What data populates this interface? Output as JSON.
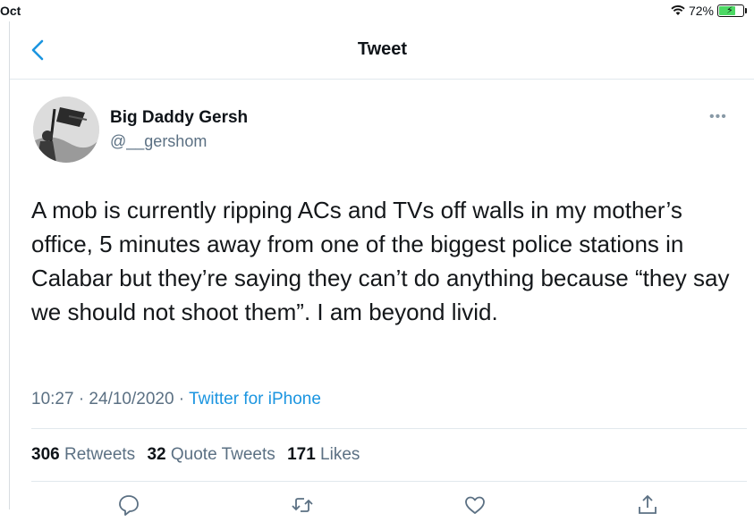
{
  "status_bar": {
    "time": "Oct",
    "battery_percent_text": "72%",
    "battery_level": 0.72
  },
  "nav": {
    "back_icon": "chevron-left-icon",
    "title": "Tweet"
  },
  "tweet": {
    "author_name": "Big Daddy Gersh",
    "author_handle": "@__gershom",
    "more_icon": "more-icon",
    "text": "A mob is currently ripping ACs and TVs off walls in my mother’s office, 5 minutes away from one of the biggest police stations in Calabar but they’re saying they can’t do anything because “they say we should not shoot them”. I am beyond livid.",
    "timestamp": "10:27 · 24/10/2020",
    "separator": " · ",
    "source": "Twitter for iPhone",
    "stats": {
      "retweets_count": "306",
      "retweets_label": "Retweets",
      "quotes_count": "32",
      "quotes_label": "Quote Tweets",
      "likes_count": "171",
      "likes_label": "Likes"
    },
    "actions": [
      "reply-icon",
      "retweet-icon",
      "like-icon",
      "share-icon"
    ]
  },
  "colors": {
    "accent": "#1b95e0",
    "secondary_text": "#5b7083",
    "divider": "#e1e8ed"
  }
}
